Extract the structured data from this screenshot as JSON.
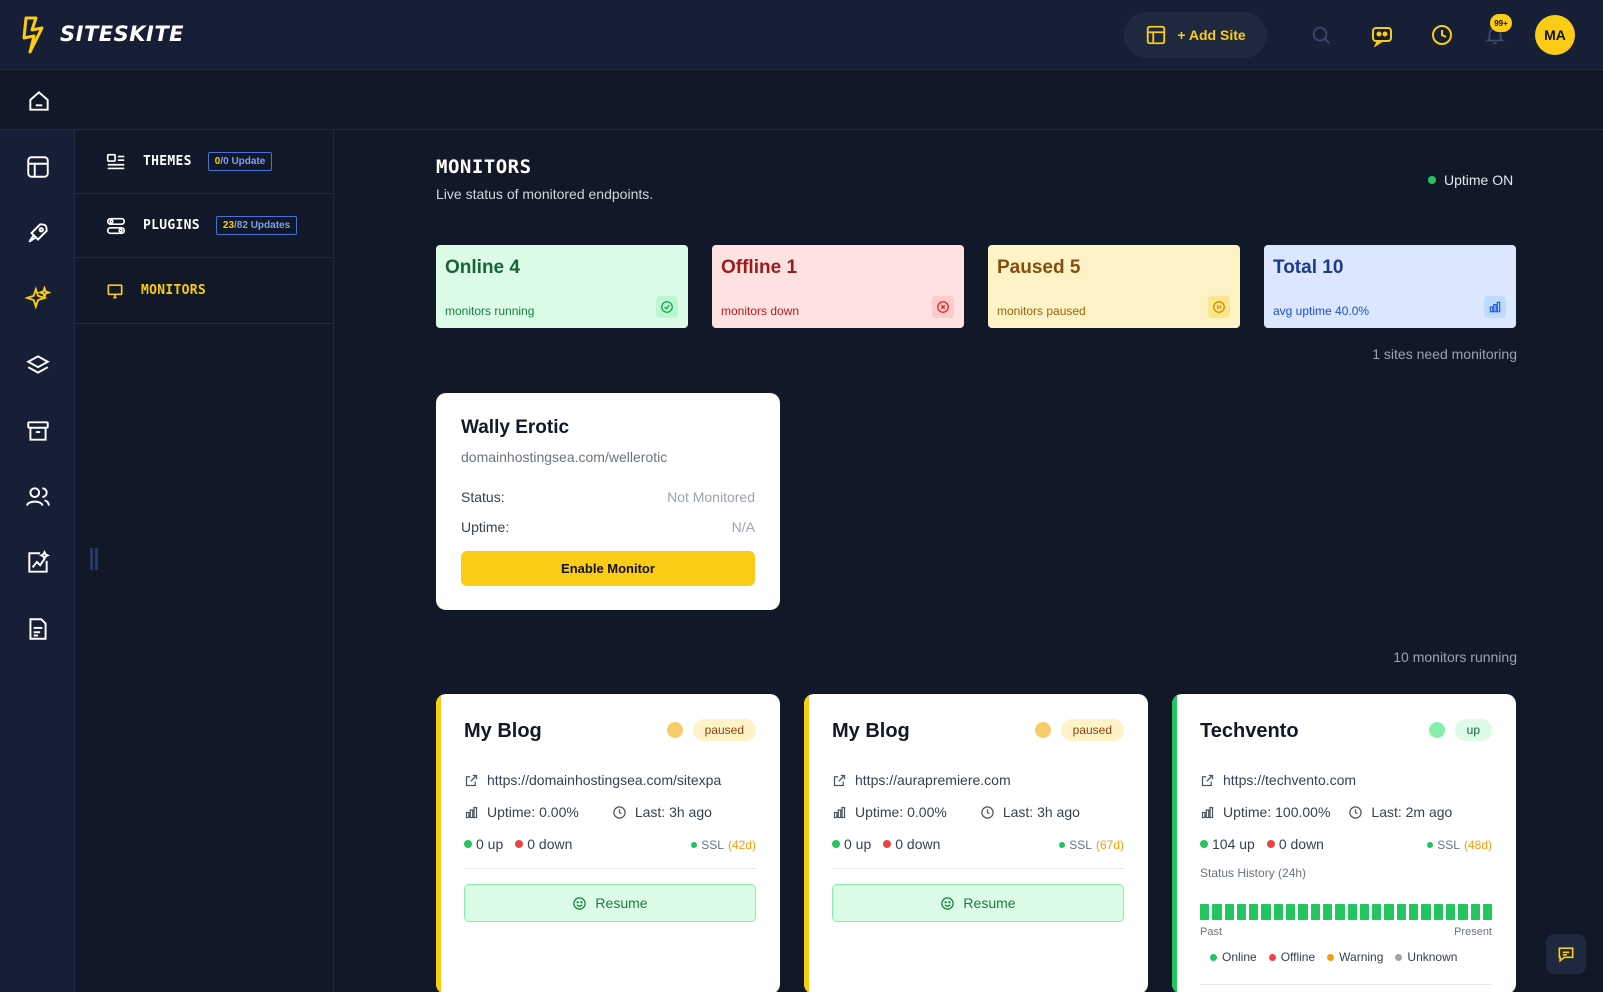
{
  "app": {
    "brand": "SITESKITE"
  },
  "topbar": {
    "add_site_label": "+ Add Site",
    "notifications_count": "99+",
    "avatar_initials": "MA"
  },
  "sidebar": {
    "items": [
      {
        "label": "THEMES",
        "badge_count": "0",
        "badge_rest": "/0 Update"
      },
      {
        "label": "PLUGINS",
        "badge_count": "23",
        "badge_rest": "/82 Updates"
      },
      {
        "label": "MONITORS"
      }
    ]
  },
  "page": {
    "title": "MONITORS",
    "subtitle": "Live status of monitored endpoints.",
    "uptime_status": "Uptime ON"
  },
  "stats": [
    {
      "label": "Online",
      "value": "4",
      "sub": "monitors running"
    },
    {
      "label": "Offline",
      "value": "1",
      "sub": "monitors down"
    },
    {
      "label": "Paused",
      "value": "5",
      "sub": "monitors paused"
    },
    {
      "label": "Total",
      "value": "10",
      "sub": "avg uptime 40.0%"
    }
  ],
  "unmonitored": {
    "section_note": "1 sites need monitoring",
    "card": {
      "name": "Wally Erotic",
      "url": "domainhostingsea.com/wellerotic",
      "status_label": "Status:",
      "status_value": "Not Monitored",
      "uptime_label": "Uptime:",
      "uptime_value": "N/A",
      "button": "Enable Monitor"
    }
  },
  "active": {
    "section_note": "10 monitors running",
    "monitors": [
      {
        "name": "My Blog",
        "status": "paused",
        "url": "https://domainhostingsea.com/sitexpa",
        "uptime": "Uptime: 0.00%",
        "last": "Last: 3h ago",
        "up": "0 up",
        "down": "0 down",
        "ssl_label": "SSL",
        "ssl_days": "(42d)",
        "button": "Resume"
      },
      {
        "name": "My Blog",
        "status": "paused",
        "url": "https://aurapremiere.com",
        "uptime": "Uptime: 0.00%",
        "last": "Last: 3h ago",
        "up": "0 up",
        "down": "0 down",
        "ssl_label": "SSL",
        "ssl_days": "(67d)",
        "button": "Resume"
      },
      {
        "name": "Techvento",
        "status": "up",
        "url": "https://techvento.com",
        "uptime": "Uptime: 100.00%",
        "last": "Last: 2m ago",
        "up": "104 up",
        "down": "0 down",
        "ssl_label": "SSL",
        "ssl_days": "(48d)",
        "history_label": "Status History (24h)",
        "past": "Past",
        "present": "Present",
        "legend": [
          "Online",
          "Offline",
          "Warning",
          "Unknown"
        ]
      }
    ]
  },
  "colors": {
    "accent": "#facc15",
    "online": "#22c55e",
    "offline": "#ef4444",
    "paused": "#f59e0b",
    "unknown": "#9ca3af"
  },
  "icons": [
    "home-icon",
    "layout-icon",
    "rocket-icon",
    "sparkles-icon",
    "layers-icon",
    "archive-icon",
    "users-icon",
    "chart-image-icon",
    "report-icon",
    "search-icon",
    "robot-chat-icon",
    "history-icon",
    "bell-icon",
    "chat-icon"
  ]
}
